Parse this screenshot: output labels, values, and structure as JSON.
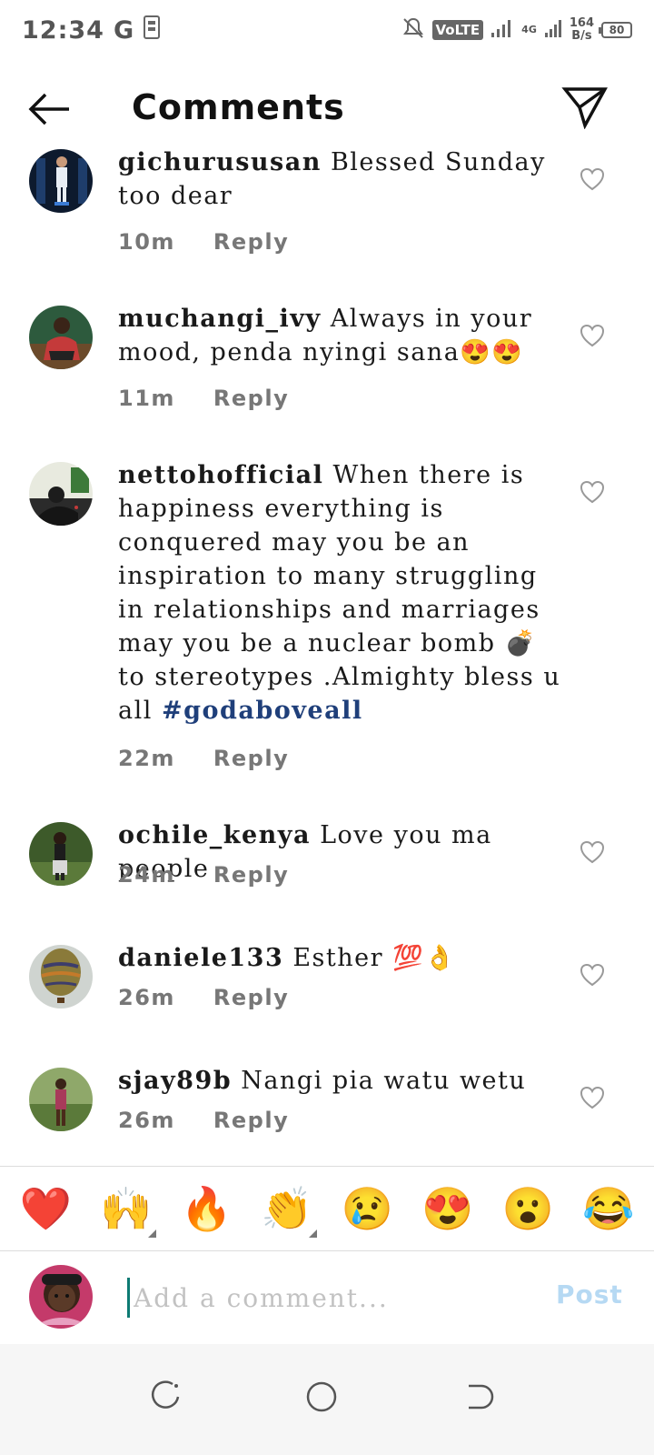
{
  "status_bar": {
    "time": "12:34",
    "carrier_letter": "G",
    "volte": "VoLTE",
    "network_type": "4G",
    "speed_value": "164",
    "speed_unit": "B/s",
    "battery": "80"
  },
  "header": {
    "title": "Comments"
  },
  "comments": [
    {
      "username": "gichurususan",
      "text": "Blessed Sunday too dear",
      "time": "10m",
      "reply_label": "Reply"
    },
    {
      "username": "muchangi_ivy",
      "text": "Always in your mood, penda nyingi sana😍😍",
      "time": "11m",
      "reply_label": "Reply"
    },
    {
      "username": "nettohofficial",
      "text": "When there is happiness everything is conquered may you be an inspiration to many struggling in relationships and marriages may you be a nuclear bomb 💣 to stereotypes .Almighty bless u all",
      "hashtag": "#godaboveall",
      "time": "22m",
      "reply_label": "Reply"
    },
    {
      "username": "ochile_kenya",
      "text": "Love you ma people",
      "time": "24m",
      "reply_label": "Reply"
    },
    {
      "username": "daniele133",
      "text": "Esther 💯👌",
      "time": "26m",
      "reply_label": "Reply"
    },
    {
      "username": "sjay89b",
      "text": "Nangi pia watu wetu",
      "time": "26m",
      "reply_label": "Reply"
    }
  ],
  "emoji_bar": [
    "❤️",
    "🙌",
    "🔥",
    "👏",
    "😢",
    "😍",
    "😮",
    "😂"
  ],
  "composer": {
    "placeholder": "Add a comment...",
    "post_label": "Post"
  },
  "colors": {
    "accent_post": "#b6d9f3",
    "hashtag": "#1f3f7a",
    "cursor": "#0d7a73"
  }
}
